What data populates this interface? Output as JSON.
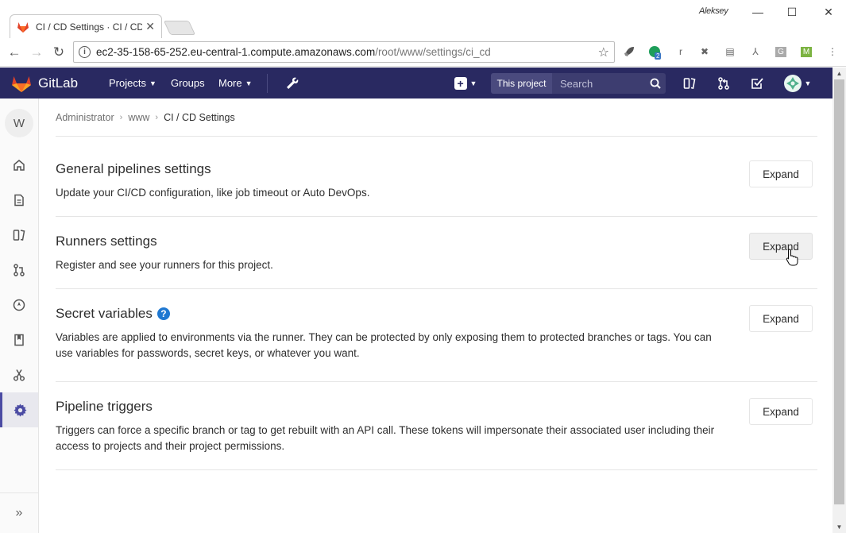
{
  "browser": {
    "tab_title": "CI / CD Settings · CI / CD",
    "user_name": "Aleksey",
    "url_host": "ec2-35-158-65-252.eu-central-1.compute.amazonaws.com",
    "url_path": "/root/www/settings/ci_cd",
    "extension_badge": "2"
  },
  "header": {
    "brand": "GitLab",
    "nav": {
      "projects": "Projects",
      "groups": "Groups",
      "more": "More"
    },
    "search_scope": "This project",
    "search_placeholder": "Search"
  },
  "sidebar": {
    "project_initial": "W"
  },
  "breadcrumb": {
    "items": [
      "Administrator",
      "www"
    ],
    "current": "CI / CD Settings"
  },
  "sections": [
    {
      "title": "General pipelines settings",
      "description": "Update your CI/CD configuration, like job timeout or Auto DevOps.",
      "button": "Expand"
    },
    {
      "title": "Runners settings",
      "description": "Register and see your runners for this project.",
      "button": "Expand"
    },
    {
      "title": "Secret variables",
      "description": "Variables are applied to environments via the runner. They can be protected by only exposing them to protected branches or tags. You can use variables for passwords, secret keys, or whatever you want.",
      "button": "Expand"
    },
    {
      "title": "Pipeline triggers",
      "description": "Triggers can force a specific branch or tag to get rebuilt with an API call. These tokens will impersonate their associated user including their access to projects and their project permissions.",
      "button": "Expand"
    }
  ],
  "colors": {
    "header_bg": "#292961",
    "accent": "#4b4ba3",
    "help_blue": "#1f78d1",
    "gitlab_orange": "#fc6d26"
  }
}
